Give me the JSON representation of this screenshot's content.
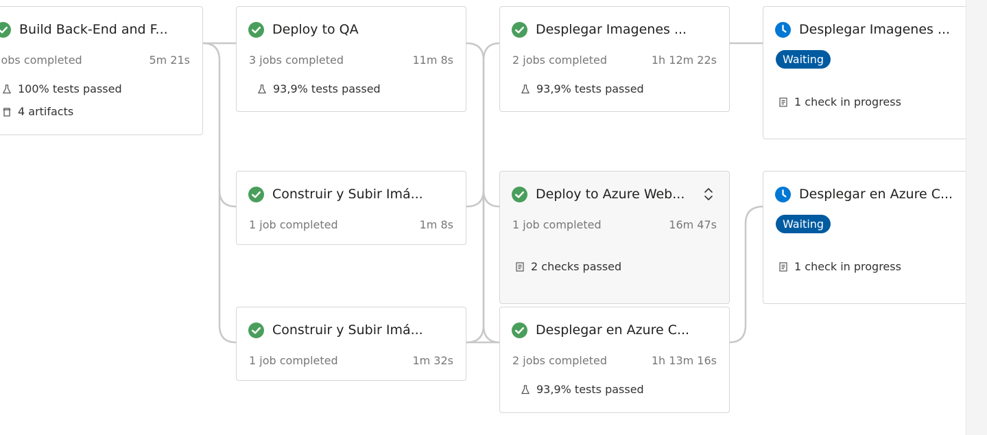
{
  "stages": {
    "build": {
      "title": "Build Back-End and F...",
      "jobs": "jobs completed",
      "duration": "5m 21s",
      "tests": "100% tests passed",
      "artifacts": "4 artifacts"
    },
    "deploy_qa": {
      "title": "Deploy to QA",
      "jobs": "3 jobs completed",
      "duration": "11m 8s",
      "tests": "93,9% tests passed"
    },
    "desplegar_imagenes_1": {
      "title": "Desplegar Imagenes ...",
      "jobs": "2 jobs completed",
      "duration": "1h 12m 22s",
      "tests": "93,9% tests passed"
    },
    "desplegar_imagenes_2": {
      "title": "Desplegar Imagenes ...",
      "badge": "Waiting",
      "checks": "1 check in progress"
    },
    "construir_1": {
      "title": "Construir y Subir Imá...",
      "jobs": "1 job completed",
      "duration": "1m 8s"
    },
    "deploy_azure_web": {
      "title": "Deploy to Azure Web...",
      "jobs": "1 job completed",
      "duration": "16m 47s",
      "checks": "2 checks passed"
    },
    "desplegar_azure_c_waiting": {
      "title": "Desplegar en Azure C...",
      "badge": "Waiting",
      "checks": "1 check in progress"
    },
    "construir_2": {
      "title": "Construir y Subir Imá...",
      "jobs": "1 job completed",
      "duration": "1m 32s"
    },
    "desplegar_azure_c": {
      "title": "Desplegar en Azure C...",
      "jobs": "2 jobs completed",
      "duration": "1h 13m 16s",
      "tests": "93,9% tests passed"
    }
  },
  "icons": {
    "success": "check-circle-icon",
    "waiting": "clock-icon",
    "tests": "flask-icon",
    "artifacts": "artifact-icon",
    "checks": "checklist-icon",
    "expand": "expand-collapse-icon"
  },
  "colors": {
    "success": "#4a9e5c",
    "waiting": "#0078d4",
    "badge": "#005ba1",
    "connector": "#c8c8c8"
  }
}
